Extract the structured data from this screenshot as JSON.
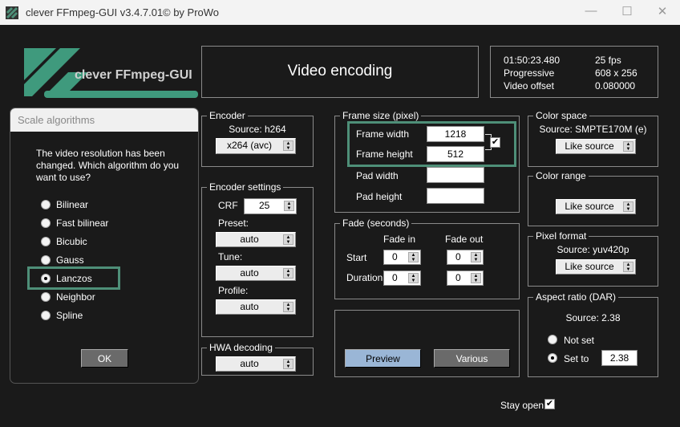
{
  "window": {
    "title": "clever FFmpeg-GUI v3.4.7.01",
    "copyright": "© by ProWo",
    "minimize": "—",
    "maximize": "☐",
    "close": "✕"
  },
  "logo": {
    "text": "clever FFmpeg-GUI"
  },
  "header": {
    "title": "Video encoding"
  },
  "info": {
    "duration": "01:50:23.480",
    "fps": "25 fps",
    "scan": "Progressive",
    "resolution": "608 x 256",
    "offset_label": "Video offset",
    "offset_value": "0.080000"
  },
  "dialog": {
    "title": "Scale algorithms",
    "message": "The video resolution has been changed. Which algorithm do you want to use?",
    "options": [
      "Bilinear",
      "Fast bilinear",
      "Bicubic",
      "Gauss",
      "Lanczos",
      "Neighbor",
      "Spline"
    ],
    "selected": "Lanczos",
    "ok": "OK"
  },
  "encoder": {
    "legend": "Encoder",
    "source": "Source: h264",
    "codec": "x264 (avc)"
  },
  "encoder_settings": {
    "legend": "Encoder settings",
    "crf_label": "CRF",
    "crf": "25",
    "preset_label": "Preset:",
    "preset": "auto",
    "tune_label": "Tune:",
    "tune": "auto",
    "profile_label": "Profile:",
    "profile": "auto"
  },
  "hwa": {
    "legend": "HWA decoding",
    "value": "auto"
  },
  "frame": {
    "legend": "Frame size (pixel)",
    "width_label": "Frame width",
    "width": "1218",
    "height_label": "Frame height",
    "height": "512",
    "pad_width_label": "Pad width",
    "pad_width": "",
    "pad_height_label": "Pad height",
    "pad_height": "",
    "link": "✔"
  },
  "fade": {
    "legend": "Fade (seconds)",
    "fade_in": "Fade in",
    "fade_out": "Fade out",
    "start": "Start",
    "duration": "Duration",
    "start_in": "0",
    "start_out": "0",
    "dur_in": "0",
    "dur_out": "0"
  },
  "actions": {
    "preview": "Preview",
    "various": "Various"
  },
  "color_space": {
    "legend": "Color space",
    "source": "Source: SMPTE170M (e)",
    "value": "Like source"
  },
  "color_range": {
    "legend": "Color range",
    "value": "Like source"
  },
  "pixel_format": {
    "legend": "Pixel format",
    "source": "Source: yuv420p",
    "value": "Like source"
  },
  "aspect": {
    "legend": "Aspect ratio (DAR)",
    "source": "Source: 2.38",
    "not_set": "Not set",
    "set_to": "Set to",
    "value": "2.38"
  },
  "stay_open": {
    "label": "Stay open",
    "check": "✔"
  },
  "colors": {
    "accent": "#4e8f78",
    "bg": "#1a1a1a"
  }
}
